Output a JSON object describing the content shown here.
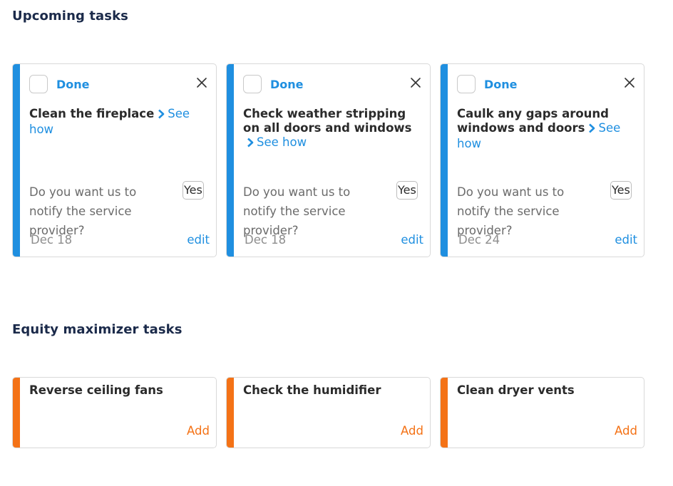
{
  "sections": {
    "upcoming_title": "Upcoming tasks",
    "equity_title": "Equity maximizer tasks"
  },
  "colors": {
    "upcoming_accent": "#1f8fe0",
    "equity_accent": "#f47216"
  },
  "upcoming": [
    {
      "done_label": "Done",
      "title": "Clean the fireplace",
      "see_how": "See how",
      "notify_text": "Do you want us to notify the service provider?",
      "yes_label": "Yes",
      "date": "Dec 18",
      "edit_label": "edit"
    },
    {
      "done_label": "Done",
      "title": "Check weather stripping on all doors and windows",
      "see_how": "See how",
      "notify_text": "Do you want us to notify the service provider?",
      "yes_label": "Yes",
      "date": "Dec 18",
      "edit_label": "edit"
    },
    {
      "done_label": "Done",
      "title": "Caulk any gaps around windows and doors",
      "see_how": "See how",
      "notify_text": "Do you want us to notify the service provider?",
      "yes_label": "Yes",
      "date": "Dec 24",
      "edit_label": "edit"
    }
  ],
  "equity": [
    {
      "title": "Reverse ceiling fans",
      "add_label": "Add"
    },
    {
      "title": "Check the humidifier",
      "add_label": "Add"
    },
    {
      "title": "Clean dryer vents",
      "add_label": "Add"
    }
  ]
}
